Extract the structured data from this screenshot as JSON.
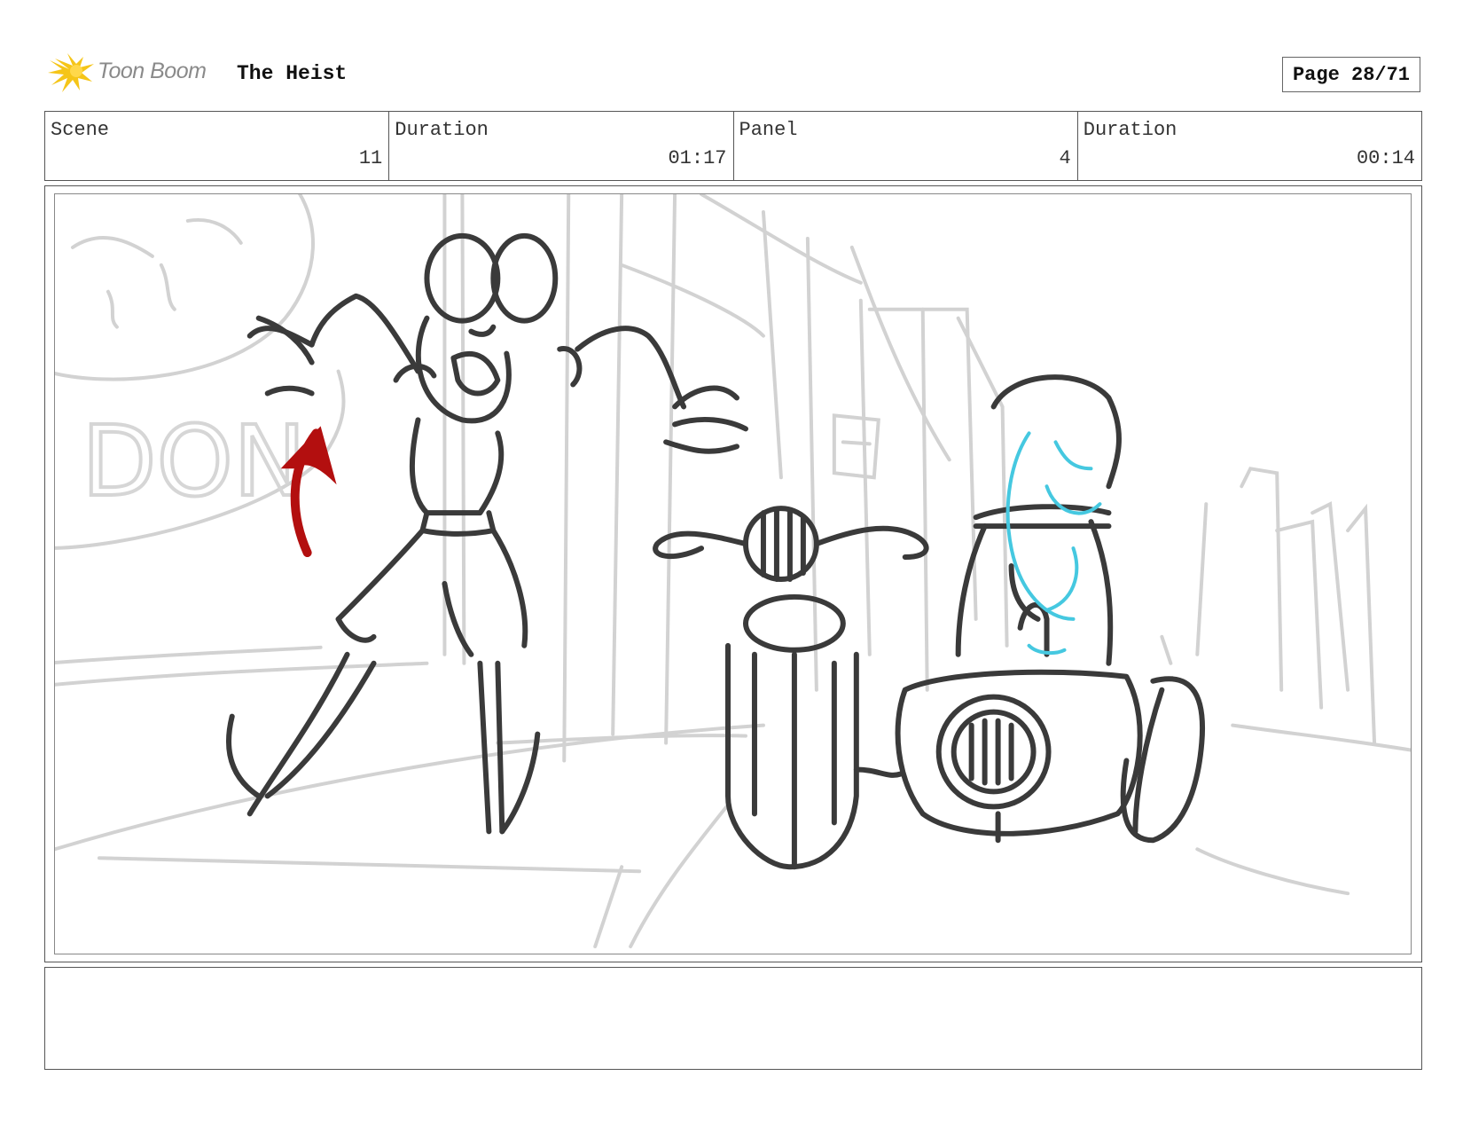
{
  "header": {
    "brand": "Toon Boom",
    "project_title": "The Heist",
    "page_label": "Page 28/71"
  },
  "info": {
    "scene_label": "Scene",
    "scene_value": "11",
    "scene_duration_label": "Duration",
    "scene_duration_value": "01:17",
    "panel_label": "Panel",
    "panel_value": "4",
    "panel_duration_label": "Duration",
    "panel_duration_value": "00:14"
  },
  "panel": {
    "background_sign_text": "DON",
    "colors": {
      "background_sketch": "#d2d2d2",
      "ink": "#3a3a3a",
      "arrow": "#b30f0f",
      "cyan_sketch": "#45c8e0",
      "logo_yellow": "#f5c518"
    }
  },
  "notes": {
    "text": ""
  }
}
